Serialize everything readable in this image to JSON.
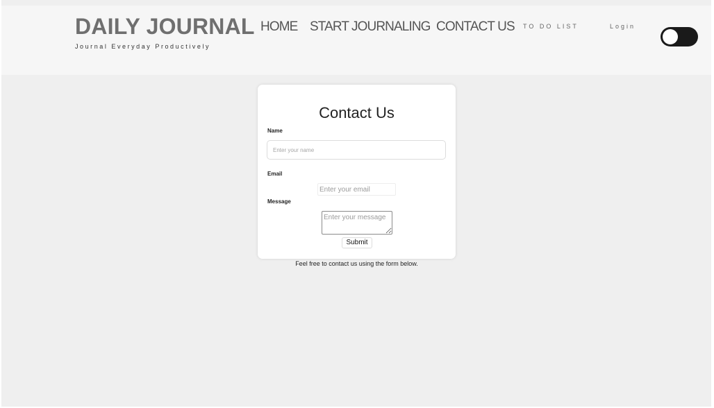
{
  "header": {
    "brand_title": "DAILY JOURNAL",
    "brand_tagline": "Journal Everyday Productively",
    "nav": {
      "home": "HOME",
      "start_journaling": "START JOURNALING",
      "contact_us": "CONTACT US",
      "todo_list": "TO DO LIST",
      "login": "Login"
    },
    "theme_toggle": {
      "icon": "theme-toggle-icon",
      "state": "off"
    }
  },
  "contact_form": {
    "title": "Contact Us",
    "name": {
      "label": "Name",
      "value": "",
      "placeholder": "Enter your name"
    },
    "email": {
      "label": "Email",
      "value": "",
      "placeholder": "Enter your email"
    },
    "message": {
      "label": "Message",
      "value": "",
      "placeholder": "Enter your message"
    },
    "submit_label": "Submit"
  },
  "footnote": "Feel free to contact us using the form below.",
  "colors": {
    "page_bg": "#efefef",
    "header_bg": "#f6f6f6",
    "brand_text": "#6f6f6f",
    "toggle_bg": "#1a1a1a"
  }
}
